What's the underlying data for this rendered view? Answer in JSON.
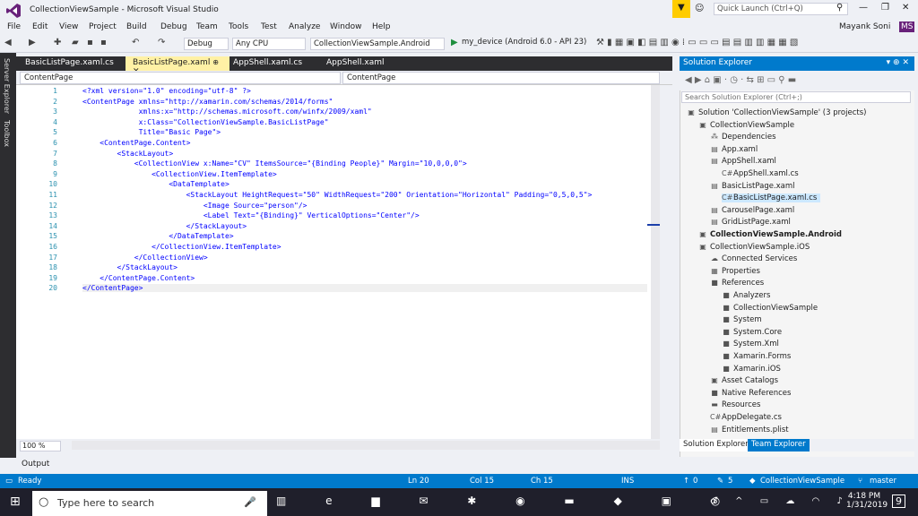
{
  "window": {
    "title": "CollectionViewSample - Microsoft Visual Studio",
    "quick_launch": "Quick Launch (Ctrl+Q)",
    "user": "Mayank Soni",
    "user_initials": "MS"
  },
  "menu": [
    "File",
    "Edit",
    "View",
    "Project",
    "Build",
    "Debug",
    "Team",
    "Tools",
    "Test",
    "Analyze",
    "Window",
    "Help"
  ],
  "toolbar": {
    "config": "Debug",
    "platform": "Any CPU",
    "project": "CollectionViewSample.Android",
    "run": "my_device (Android 6.0 - API 23)"
  },
  "left_strip": [
    "Server Explorer",
    "Toolbox"
  ],
  "doc_tabs": [
    {
      "label": "BasicListPage.xaml.cs",
      "active": false
    },
    {
      "label": "BasicListPage.xaml",
      "active": true
    },
    {
      "label": "AppShell.xaml.cs",
      "active": false
    },
    {
      "label": "AppShell.xaml",
      "active": false
    }
  ],
  "nav": {
    "left": "ContentPage",
    "right": "ContentPage"
  },
  "code": [
    "<?xml version=\"1.0\" encoding=\"utf-8\" ?>",
    "<ContentPage xmlns=\"http://xamarin.com/schemas/2014/forms\"",
    "             xmlns:x=\"http://schemas.microsoft.com/winfx/2009/xaml\"",
    "             x:Class=\"CollectionViewSample.BasicListPage\"",
    "             Title=\"Basic Page\">",
    "    <ContentPage.Content>",
    "        <StackLayout>",
    "            <CollectionView x:Name=\"CV\" ItemsSource=\"{Binding People}\" Margin=\"10,0,0,0\">",
    "                <CollectionView.ItemTemplate>",
    "                    <DataTemplate>",
    "                        <StackLayout HeightRequest=\"50\" WidthRequest=\"200\" Orientation=\"Horizontal\" Padding=\"0,5,0,5\">",
    "                            <Image Source=\"person\"/>",
    "                            <Label Text=\"{Binding}\" VerticalOptions=\"Center\"/>",
    "                        </StackLayout>",
    "                    </DataTemplate>",
    "                </CollectionView.ItemTemplate>",
    "            </CollectionView>",
    "        </StackLayout>",
    "    </ContentPage.Content>",
    "</ContentPage>"
  ],
  "editor": {
    "zoom": "100 %"
  },
  "output_label": "Output",
  "status": {
    "ready": "Ready",
    "ln": "Ln 20",
    "col": "Col 15",
    "ch": "Ch 15",
    "ins": "INS",
    "up": "0",
    "pencil": "5",
    "repo": "CollectionViewSample",
    "branch": "master"
  },
  "solution_explorer": {
    "title": "Solution Explorer",
    "search": "Search Solution Explorer (Ctrl+;)",
    "items": [
      {
        "label": "Solution 'CollectionViewSample' (3 projects)",
        "indent": 0,
        "icon": "▣",
        "bold": false
      },
      {
        "label": "CollectionViewSample",
        "indent": 1,
        "icon": "▣",
        "bold": false
      },
      {
        "label": "Dependencies",
        "indent": 2,
        "icon": "⁂",
        "bold": false
      },
      {
        "label": "App.xaml",
        "indent": 2,
        "icon": "▤",
        "bold": false
      },
      {
        "label": "AppShell.xaml",
        "indent": 2,
        "icon": "▤",
        "bold": false
      },
      {
        "label": "AppShell.xaml.cs",
        "indent": 3,
        "icon": "C#",
        "bold": false
      },
      {
        "label": "BasicListPage.xaml",
        "indent": 2,
        "icon": "▤",
        "bold": false
      },
      {
        "label": "BasicListPage.xaml.cs",
        "indent": 3,
        "icon": "C#",
        "bold": false,
        "selected": true
      },
      {
        "label": "CarouselPage.xaml",
        "indent": 2,
        "icon": "▤",
        "bold": false
      },
      {
        "label": "GridListPage.xaml",
        "indent": 2,
        "icon": "▤",
        "bold": false
      },
      {
        "label": "CollectionViewSample.Android",
        "indent": 1,
        "icon": "▣",
        "bold": true
      },
      {
        "label": "CollectionViewSample.iOS",
        "indent": 1,
        "icon": "▣",
        "bold": false
      },
      {
        "label": "Connected Services",
        "indent": 2,
        "icon": "☁",
        "bold": false
      },
      {
        "label": "Properties",
        "indent": 2,
        "icon": "▦",
        "bold": false
      },
      {
        "label": "References",
        "indent": 2,
        "icon": "■",
        "bold": false
      },
      {
        "label": "Analyzers",
        "indent": 3,
        "icon": "■",
        "bold": false
      },
      {
        "label": "CollectionViewSample",
        "indent": 3,
        "icon": "■",
        "bold": false
      },
      {
        "label": "System",
        "indent": 3,
        "icon": "■",
        "bold": false
      },
      {
        "label": "System.Core",
        "indent": 3,
        "icon": "■",
        "bold": false
      },
      {
        "label": "System.Xml",
        "indent": 3,
        "icon": "■",
        "bold": false
      },
      {
        "label": "Xamarin.Forms",
        "indent": 3,
        "icon": "■",
        "bold": false
      },
      {
        "label": "Xamarin.iOS",
        "indent": 3,
        "icon": "■",
        "bold": false
      },
      {
        "label": "Asset Catalogs",
        "indent": 2,
        "icon": "▣",
        "bold": false
      },
      {
        "label": "Native References",
        "indent": 2,
        "icon": "■",
        "bold": false
      },
      {
        "label": "Resources",
        "indent": 2,
        "icon": "▬",
        "bold": false
      },
      {
        "label": "AppDelegate.cs",
        "indent": 2,
        "icon": "C#",
        "bold": false
      },
      {
        "label": "Entitlements.plist",
        "indent": 2,
        "icon": "▤",
        "bold": false
      }
    ],
    "tabs": [
      "Solution Explorer",
      "Team Explorer"
    ]
  },
  "taskbar": {
    "search": "Type here to search",
    "time": "4:18 PM",
    "date": "1/31/2019",
    "notifications": "9"
  }
}
